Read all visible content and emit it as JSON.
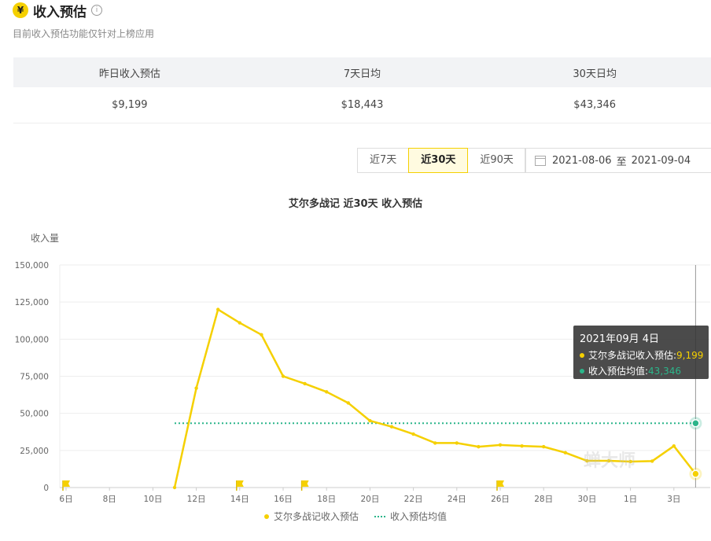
{
  "header": {
    "title": "收入预估",
    "subtitle": "目前收入预估功能仅针对上榜应用",
    "icon": "yen-icon"
  },
  "stats": {
    "headers": [
      "昨日收入预估",
      "7天日均",
      "30天日均"
    ],
    "values": [
      "$9,199",
      "$18,443",
      "$43,346"
    ]
  },
  "range_buttons": [
    "近7天",
    "近30天",
    "近90天"
  ],
  "active_range": "近30天",
  "date_range": {
    "start": "2021-08-06",
    "sep": "至",
    "end": "2021-09-04"
  },
  "tooltip": {
    "date": "2021年09月 4日",
    "row1_label": "艾尔多战记收入预估: ",
    "row1_value": "9,199",
    "row2_label": "收入预估均值: ",
    "row2_value": "43,346"
  },
  "watermark": "蝉大师",
  "colors": {
    "accent": "#f5d000",
    "avg_line": "#2bb58a"
  },
  "chart_data": {
    "type": "line",
    "title": "艾尔多战记 近30天 收入预估",
    "ylabel": "收入量",
    "ylim": [
      0,
      150000
    ],
    "yticks": [
      "0",
      "25,000",
      "50,000",
      "75,000",
      "100,000",
      "125,000",
      "150,000"
    ],
    "xtick_labels": [
      "6日",
      "8日",
      "10日",
      "12日",
      "14日",
      "16日",
      "18日",
      "20日",
      "22日",
      "24日",
      "26日",
      "28日",
      "30日",
      "1日",
      "3日"
    ],
    "x": [
      "2021-08-06",
      "2021-08-07",
      "2021-08-08",
      "2021-08-09",
      "2021-08-10",
      "2021-08-11",
      "2021-08-12",
      "2021-08-13",
      "2021-08-14",
      "2021-08-15",
      "2021-08-16",
      "2021-08-17",
      "2021-08-18",
      "2021-08-19",
      "2021-08-20",
      "2021-08-21",
      "2021-08-22",
      "2021-08-23",
      "2021-08-24",
      "2021-08-25",
      "2021-08-26",
      "2021-08-27",
      "2021-08-28",
      "2021-08-29",
      "2021-08-30",
      "2021-08-31",
      "2021-09-01",
      "2021-09-02",
      "2021-09-03",
      "2021-09-04"
    ],
    "series": [
      {
        "name": "艾尔多战记收入预估",
        "color": "#f5d000",
        "values": [
          null,
          null,
          null,
          null,
          null,
          0,
          67000,
          120000,
          111000,
          103000,
          75000,
          70000,
          64500,
          57000,
          45000,
          41000,
          36000,
          30000,
          30000,
          27500,
          28700,
          28000,
          27500,
          23500,
          18000,
          18000,
          17500,
          17800,
          28000,
          9199
        ]
      },
      {
        "name": "收入预估均值",
        "color": "#2bb58a",
        "style": "dotted",
        "value": 43346,
        "start": "2021-08-11",
        "end": "2021-09-04"
      }
    ],
    "markers": [
      {
        "x": "2021-08-06",
        "icon": "flag-icon"
      },
      {
        "x": "2021-08-14",
        "icon": "flag-icon"
      },
      {
        "x": "2021-08-17",
        "icon": "flag-icon"
      },
      {
        "x": "2021-08-26",
        "icon": "flag-icon"
      }
    ],
    "legend": [
      "艾尔多战记收入预估",
      "收入预估均值"
    ],
    "legend_position": "bottom",
    "grid": true
  }
}
